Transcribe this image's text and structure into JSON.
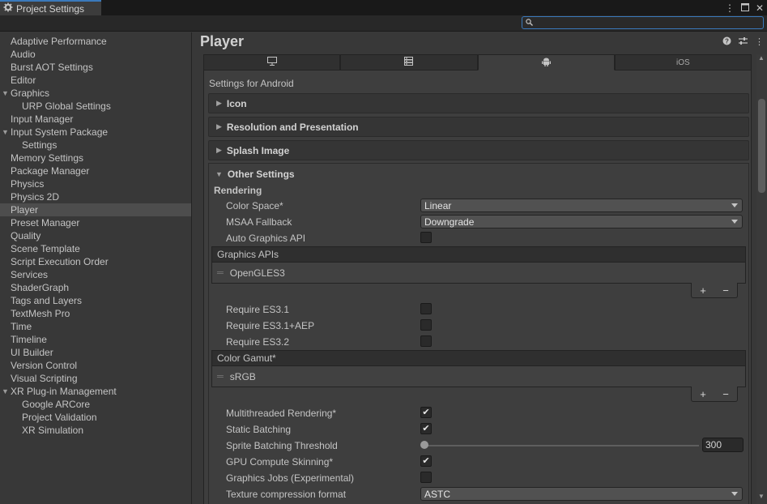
{
  "window": {
    "title": "Project Settings",
    "title_icon": "gear-icon",
    "controls": [
      "more-icon",
      "maximize-icon",
      "close-icon"
    ]
  },
  "search": {
    "value": "",
    "placeholder": ""
  },
  "sidebar": {
    "items": [
      {
        "label": "Adaptive Performance",
        "level": 0
      },
      {
        "label": "Audio",
        "level": 0
      },
      {
        "label": "Burst AOT Settings",
        "level": 0
      },
      {
        "label": "Editor",
        "level": 0
      },
      {
        "label": "Graphics",
        "level": 0,
        "expanded": true
      },
      {
        "label": "URP Global Settings",
        "level": 1
      },
      {
        "label": "Input Manager",
        "level": 0
      },
      {
        "label": "Input System Package",
        "level": 0,
        "expanded": true
      },
      {
        "label": "Settings",
        "level": 1
      },
      {
        "label": "Memory Settings",
        "level": 0
      },
      {
        "label": "Package Manager",
        "level": 0
      },
      {
        "label": "Physics",
        "level": 0
      },
      {
        "label": "Physics 2D",
        "level": 0
      },
      {
        "label": "Player",
        "level": 0,
        "selected": true
      },
      {
        "label": "Preset Manager",
        "level": 0
      },
      {
        "label": "Quality",
        "level": 0
      },
      {
        "label": "Scene Template",
        "level": 0
      },
      {
        "label": "Script Execution Order",
        "level": 0
      },
      {
        "label": "Services",
        "level": 0
      },
      {
        "label": "ShaderGraph",
        "level": 0
      },
      {
        "label": "Tags and Layers",
        "level": 0
      },
      {
        "label": "TextMesh Pro",
        "level": 0
      },
      {
        "label": "Time",
        "level": 0
      },
      {
        "label": "Timeline",
        "level": 0
      },
      {
        "label": "UI Builder",
        "level": 0
      },
      {
        "label": "Version Control",
        "level": 0
      },
      {
        "label": "Visual Scripting",
        "level": 0
      },
      {
        "label": "XR Plug-in Management",
        "level": 0,
        "expanded": true
      },
      {
        "label": "Google ARCore",
        "level": 1
      },
      {
        "label": "Project Validation",
        "level": 1
      },
      {
        "label": "XR Simulation",
        "level": 1
      }
    ]
  },
  "main": {
    "title": "Player",
    "header_icons": [
      "help-icon",
      "preset-icon",
      "more-icon"
    ],
    "platform_tabs": [
      {
        "icon": "monitor-icon",
        "label": ""
      },
      {
        "icon": "server-icon",
        "label": ""
      },
      {
        "icon": "android-icon",
        "label": "",
        "active": true
      },
      {
        "icon": "",
        "label": "iOS"
      }
    ],
    "settings_for": "Settings for Android",
    "sections": {
      "icon": "Icon",
      "resolution": "Resolution and Presentation",
      "splash": "Splash Image",
      "other": "Other Settings"
    },
    "rendering": {
      "heading": "Rendering",
      "color_space_label": "Color Space*",
      "color_space_value": "Linear",
      "msaa_label": "MSAA Fallback",
      "msaa_value": "Downgrade",
      "auto_graphics_label": "Auto Graphics API",
      "auto_graphics_checked": false,
      "graphics_apis_header": "Graphics APIs",
      "graphics_apis_items": [
        "OpenGLES3"
      ],
      "require_es31_label": "Require ES3.1",
      "require_es31aep_label": "Require ES3.1+AEP",
      "require_es32_label": "Require ES3.2",
      "color_gamut_header": "Color Gamut*",
      "color_gamut_items": [
        "sRGB"
      ],
      "multithreaded_label": "Multithreaded Rendering*",
      "multithreaded_checked": true,
      "static_batching_label": "Static Batching",
      "static_batching_checked": true,
      "sprite_threshold_label": "Sprite Batching Threshold",
      "sprite_threshold_value": "300",
      "gpu_skinning_label": "GPU Compute Skinning*",
      "gpu_skinning_checked": true,
      "graphics_jobs_label": "Graphics Jobs (Experimental)",
      "graphics_jobs_checked": false,
      "texture_compression_label": "Texture compression format",
      "texture_compression_value": "ASTC"
    }
  },
  "colors": {
    "accent": "#3a79bb",
    "panel": "#3e3e3e",
    "sidebar": "#383838",
    "selected": "#4d4d4d"
  }
}
